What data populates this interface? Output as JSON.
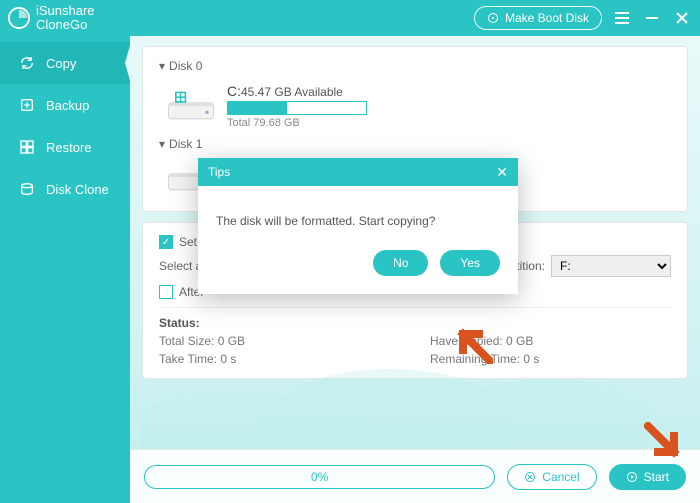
{
  "app": {
    "name": "iSunshare",
    "product": "CloneGo"
  },
  "titlebar": {
    "boot": "Make Boot Disk"
  },
  "sidebar": {
    "items": [
      {
        "label": "Copy"
      },
      {
        "label": "Backup"
      },
      {
        "label": "Restore"
      },
      {
        "label": "Disk Clone"
      }
    ]
  },
  "disks": {
    "d0": {
      "header": "Disk 0",
      "drive": "C:",
      "avail": "45.47 GB Available",
      "total": "Total 79.68 GB",
      "pct": 43
    },
    "d1": {
      "header": "Disk 1"
    }
  },
  "options": {
    "set_label": "Set t",
    "select_text": "Select a",
    "partition_label": "artition:",
    "partition_value": "F:",
    "after_label": "After"
  },
  "status": {
    "header": "Status:",
    "total": "Total Size: 0 GB",
    "copied": "Have Copied: 0 GB",
    "take": "Take Time: 0 s",
    "remain": "Remaining Time: 0 s"
  },
  "bottom": {
    "pct": "0%",
    "cancel": "Cancel",
    "start": "Start"
  },
  "modal": {
    "title": "Tips",
    "msg": "The disk will be formatted. Start copying?",
    "no": "No",
    "yes": "Yes"
  }
}
